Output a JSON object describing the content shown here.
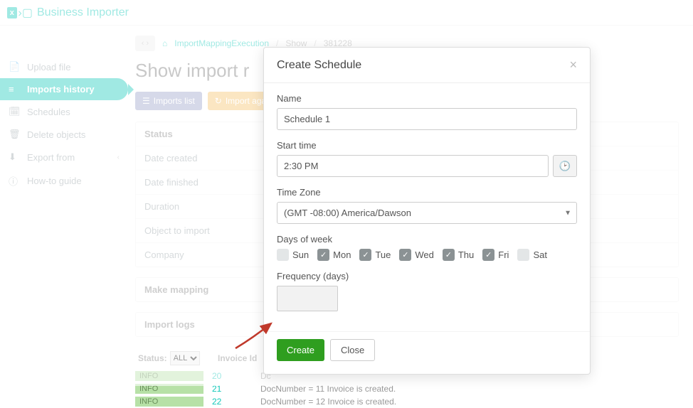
{
  "header": {
    "brand": "Business Importer"
  },
  "sidebar": {
    "items": [
      {
        "icon": "📄",
        "label": "Upload file"
      },
      {
        "icon": "≡",
        "label": "Imports history"
      },
      {
        "icon": "🗓",
        "label": "Schedules"
      },
      {
        "icon": "🗑",
        "label": "Delete objects"
      },
      {
        "icon": "⬇",
        "label": "Export from"
      },
      {
        "icon": "ⓘ",
        "label": "How-to guide"
      }
    ]
  },
  "breadcrumb": {
    "link": "ImportMappingExecution",
    "show": "Show",
    "id": "381228"
  },
  "page_title": "Show import r",
  "buttons": {
    "imports_list": "Imports list",
    "import_again": "Import agai"
  },
  "info_rows": [
    "Status",
    "Date created",
    "Date finished",
    "Duration",
    "Object to import",
    "Company",
    "Make mapping",
    "Import logs"
  ],
  "table": {
    "status_label": "Status:",
    "status_value": "ALL",
    "invoice_col": "Invoice Id",
    "rows": [
      {
        "level": "INFO",
        "id": "20",
        "msg": "Dc"
      },
      {
        "level": "INFO",
        "id": "21",
        "msg": "DocNumber = 11   Invoice is created."
      },
      {
        "level": "INFO",
        "id": "22",
        "msg": "DocNumber = 12   Invoice is created."
      }
    ]
  },
  "modal": {
    "title": "Create Schedule",
    "name_label": "Name",
    "name_value": "Schedule 1",
    "start_label": "Start time",
    "start_value": "2:30 PM",
    "tz_label": "Time Zone",
    "tz_value": "(GMT -08:00) America/Dawson",
    "days_label": "Days of week",
    "days": [
      {
        "label": "Sun",
        "checked": false
      },
      {
        "label": "Mon",
        "checked": true
      },
      {
        "label": "Tue",
        "checked": true
      },
      {
        "label": "Wed",
        "checked": true
      },
      {
        "label": "Thu",
        "checked": true
      },
      {
        "label": "Fri",
        "checked": true
      },
      {
        "label": "Sat",
        "checked": false
      }
    ],
    "freq_label": "Frequency (days)",
    "create": "Create",
    "close": "Close"
  }
}
